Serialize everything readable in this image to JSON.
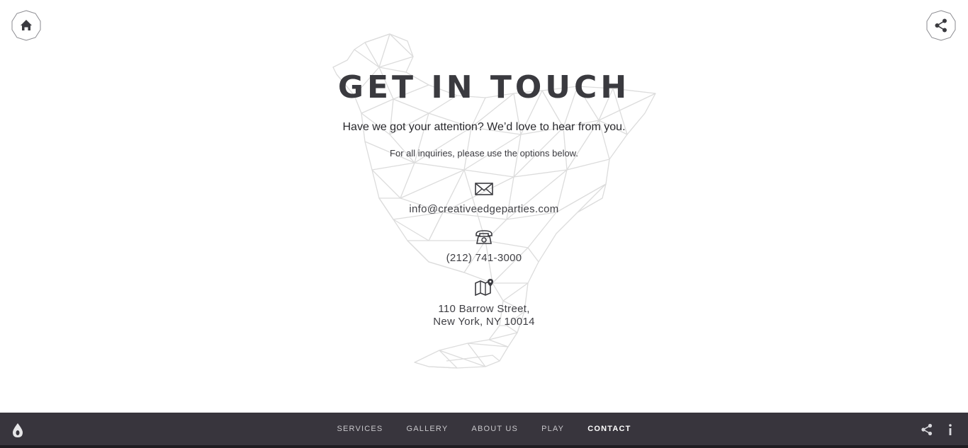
{
  "header": {
    "home_icon": "home-icon",
    "share_icon": "share-icon"
  },
  "main": {
    "title": "GET IN TOUCH",
    "subtitle": "Have we got your attention? We’d love to hear from you.",
    "note": "For all inquiries, please use the options below.",
    "email": {
      "icon": "envelope-icon",
      "value": "info@creativeedgeparties.com"
    },
    "phone": {
      "icon": "telephone-icon",
      "value": "(212) 741-3000"
    },
    "address": {
      "icon": "map-pin-icon",
      "line1": "110 Barrow Street,",
      "line2": "New York, NY 10014"
    },
    "background_art": "polygon-rooster-illustration"
  },
  "footer": {
    "logo_icon": "drop-logo-icon",
    "nav": [
      {
        "label": "SERVICES",
        "active": false
      },
      {
        "label": "GALLERY",
        "active": false
      },
      {
        "label": "ABOUT US",
        "active": false
      },
      {
        "label": "PLAY",
        "active": false
      },
      {
        "label": "CONTACT",
        "active": true
      }
    ],
    "share_icon": "share-icon",
    "info_icon": "info-icon"
  },
  "colors": {
    "text": "#3a3a3f",
    "footer_bg": "#38353d",
    "footer_text": "#c9c8cc",
    "footer_active": "#ffffff",
    "art_stroke": "#dcdcdc"
  }
}
